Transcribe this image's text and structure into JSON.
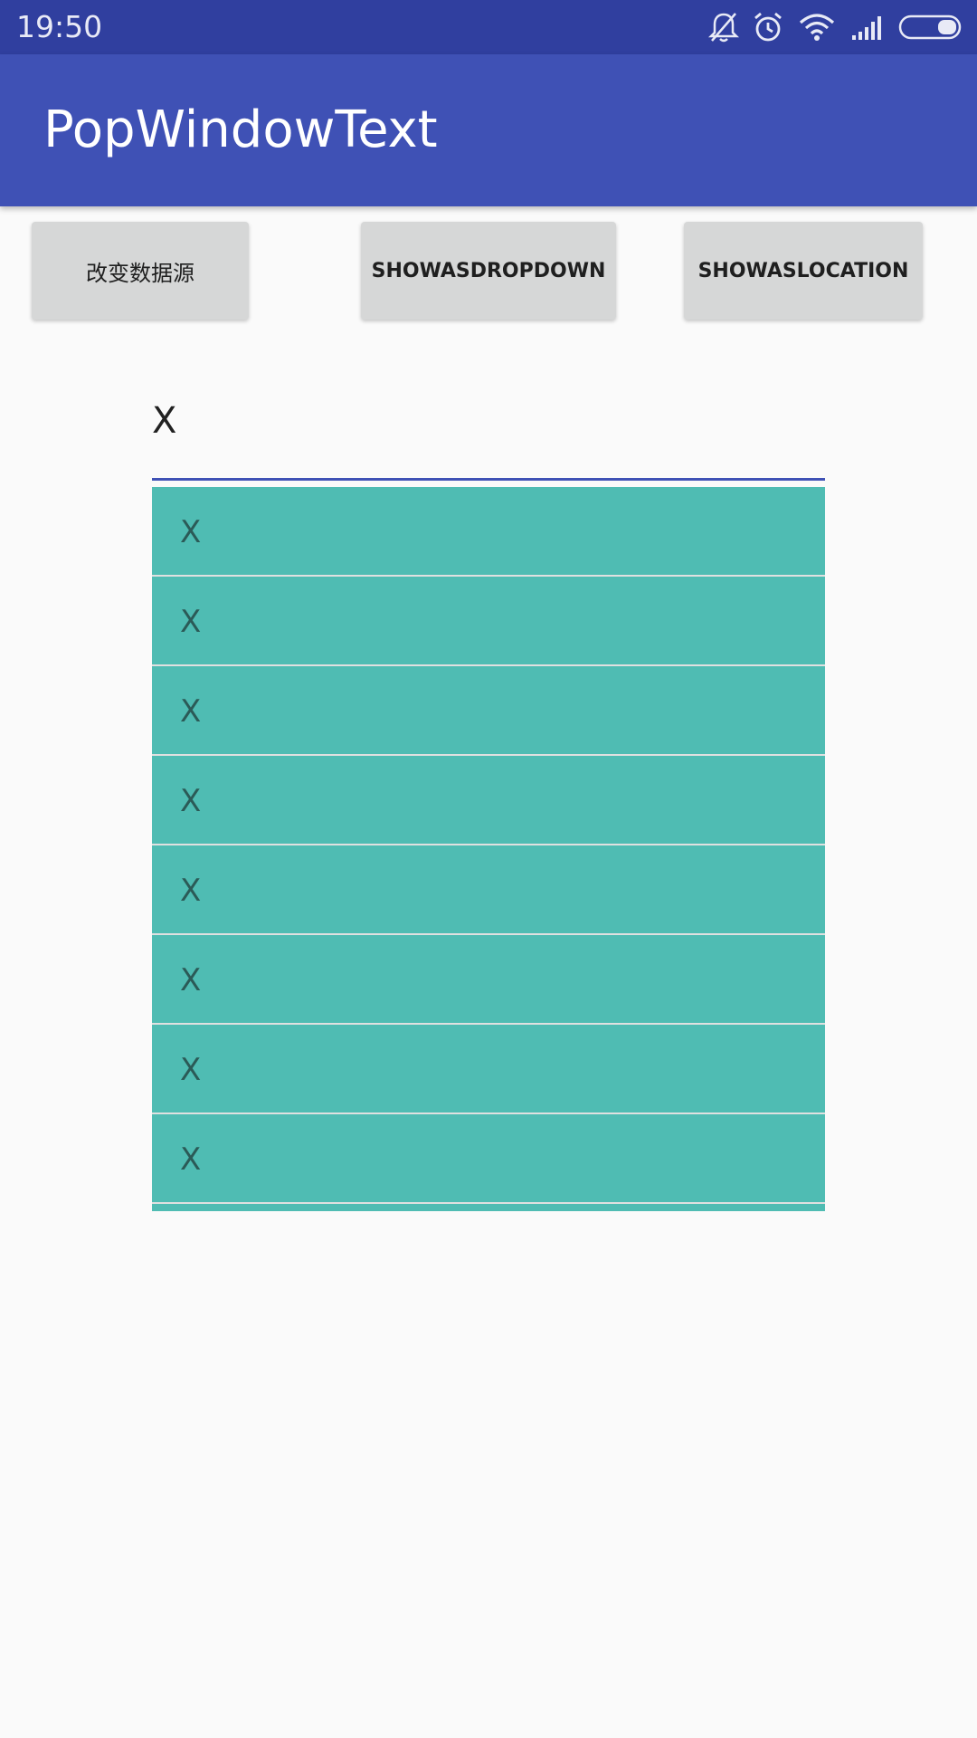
{
  "status_bar": {
    "time": "19:50",
    "icons": [
      "notifications-off-icon",
      "alarm-icon",
      "wifi-icon",
      "signal-icon",
      "battery-icon"
    ]
  },
  "app_bar": {
    "title": "PopWindowText",
    "color": "#3f51b5"
  },
  "buttons": {
    "change_data": "改变数据源",
    "show_as_dropdown": "SHOWASDROPDOWN",
    "show_as_location": "SHOWASLOCATION"
  },
  "input": {
    "value": "X"
  },
  "popup": {
    "background": "#4fbcb3",
    "items": [
      "X",
      "X",
      "X",
      "X",
      "X",
      "X",
      "X",
      "X"
    ]
  }
}
